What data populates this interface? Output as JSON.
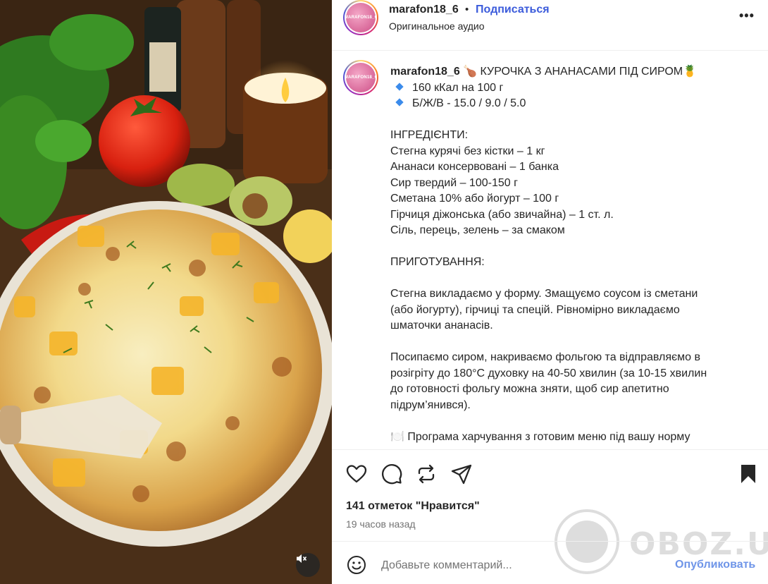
{
  "post": {
    "username": "marafon18_6",
    "avatar_text": "MARAFON18_6",
    "separator": "•",
    "follow_label": "Подписаться",
    "audio_label": "Оригинальное аудио",
    "more_label": "•••"
  },
  "caption": {
    "username": "marafon18_6",
    "title": " 🍗 КУРОЧКА З АНАНАСАМИ ПІД СИРОМ🍍",
    "bullet1": "160 кКал на 100 г",
    "bullet2": "Б/Ж/В - 15.0 / 9.0 / 5.0",
    "ingredients_heading": "ІНГРЕДІЄНТИ:",
    "ingredients": [
      "Стегна курячі без кістки – 1 кг",
      "Ананаси консервовані – 1 банка",
      "Сир твердий – 100-150 г",
      "Сметана 10% або йогурт – 100 г",
      "Гірчиця діжонська (або звичайна) – 1 ст. л.",
      "Сіль, перець, зелень – за смаком"
    ],
    "preparation_heading": "ПРИГОТУВАННЯ:",
    "step1": [
      "Стегна викладаємо у форму. Змащуємо соусом із сметани",
      "(або йогурту), гірчиці та спецій. Рівномірно викладаємо",
      "шматочки ананасів."
    ],
    "step2": [
      "Посипаємо сиром, накриваємо фольгою та відправляємо в",
      "розігріту до 180°С духовку на 40-50 хвилин (за 10-15 хвилин",
      "до готовності фольгу можна зняти, щоб сир апетитно",
      "підрум’янився)."
    ],
    "program_line": "🍽️ Програма харчування з готовим меню під вашу норму"
  },
  "actions": {
    "likes_label": "141 отметок \"Нравится\"",
    "time_label": "19 часов назад"
  },
  "comment": {
    "placeholder": "Добавьте комментарий...",
    "publish_label": "Опубликовать"
  },
  "watermark": {
    "text": "OBOZ.UA"
  },
  "colors": {
    "follow": "#3b5bdb",
    "publish": "#6f95e8",
    "text": "#262626",
    "muted": "#737373",
    "bullet": "#3b8beb"
  },
  "icons": [
    "heart-icon",
    "comment-icon",
    "repost-icon",
    "share-icon",
    "bookmark-icon",
    "emoji-icon",
    "mute-icon",
    "more-icon"
  ]
}
